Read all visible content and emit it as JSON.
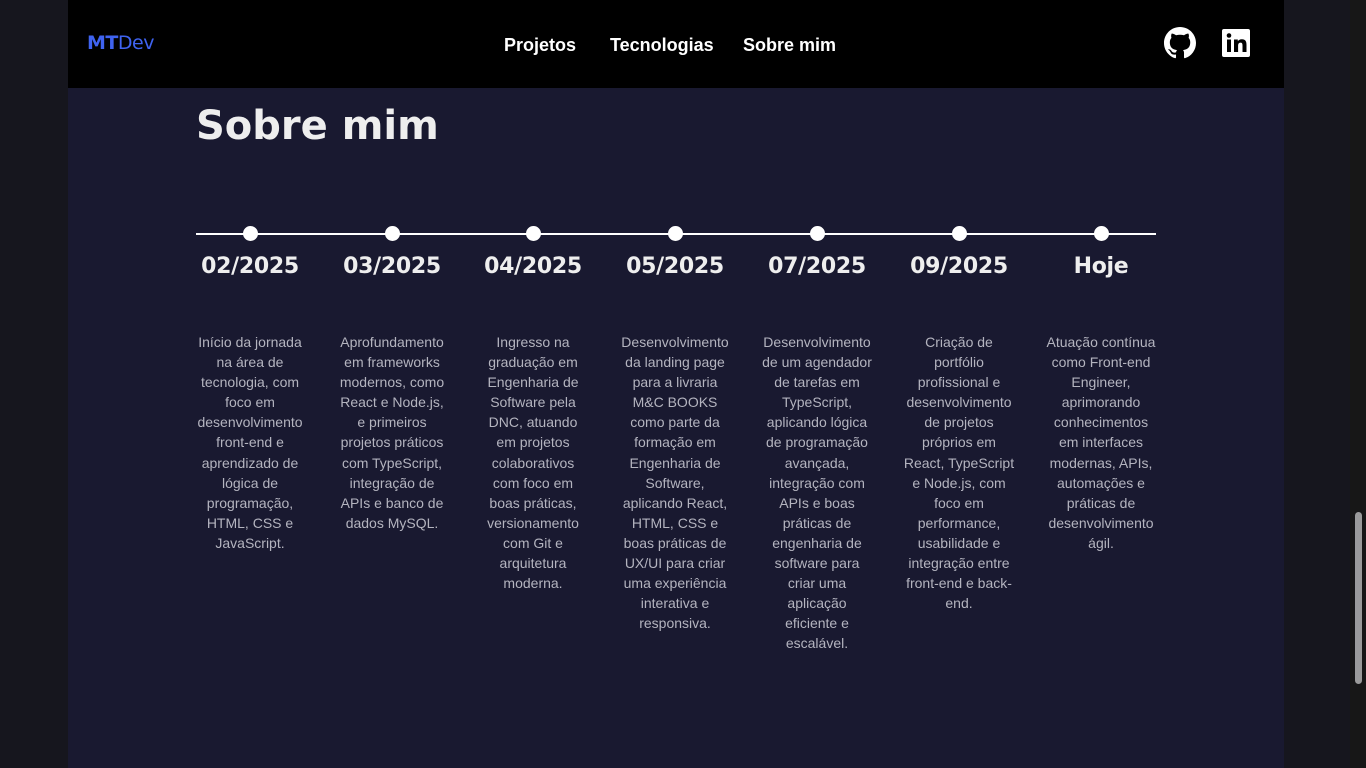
{
  "logo": {
    "part1": "MT",
    "part2": "Dev"
  },
  "nav": [
    {
      "label": "Projetos"
    },
    {
      "label": "Tecnologias"
    },
    {
      "label": "Sobre mim"
    }
  ],
  "social": [
    {
      "icon": "github-icon"
    },
    {
      "icon": "linkedin-icon"
    }
  ],
  "section": {
    "title": "Sobre mim"
  },
  "timeline": [
    {
      "date": "02/2025",
      "description": "Início da jornada na área de tecnologia, com foco em desenvolvimento front-end e aprendizado de lógica de programação, HTML, CSS e JavaScript."
    },
    {
      "date": "03/2025",
      "description": "Aprofundamento em frameworks modernos, como React e Node.js, e primeiros projetos práticos com TypeScript, integração de APIs e banco de dados MySQL."
    },
    {
      "date": "04/2025",
      "description": "Ingresso na graduação em Engenharia de Software pela DNC, atuando em projetos colaborativos com foco em boas práticas, versionamento com Git e arquitetura moderna."
    },
    {
      "date": "05/2025",
      "description": "Desenvolvimento da landing page para a livraria M&C BOOKS como parte da formação em Engenharia de Software, aplicando React, HTML, CSS e boas práticas de UX/UI para criar uma experiência interativa e responsiva."
    },
    {
      "date": "07/2025",
      "description": "Desenvolvimento de um agendador de tarefas em TypeScript, aplicando lógica de programação avançada, integração com APIs e boas práticas de engenharia de software para criar uma aplicação eficiente e escalável."
    },
    {
      "date": "09/2025",
      "description": "Criação de portfólio profissional e desenvolvimento de projetos próprios em React, TypeScript e Node.js, com foco em performance, usabilidade e integração entre front-end e back-end."
    },
    {
      "date": "Hoje",
      "description": "Atuação contínua como Front-end Engineer, aprimorando conhecimentos em interfaces modernas, APIs, automações e práticas de desenvolvimento ágil."
    }
  ],
  "colors": {
    "page_background": "#191930",
    "header_background": "#000000",
    "logo_accent": "#3f63f0",
    "text_primary": "#eeeeee",
    "text_secondary": "#b4b4bf"
  }
}
